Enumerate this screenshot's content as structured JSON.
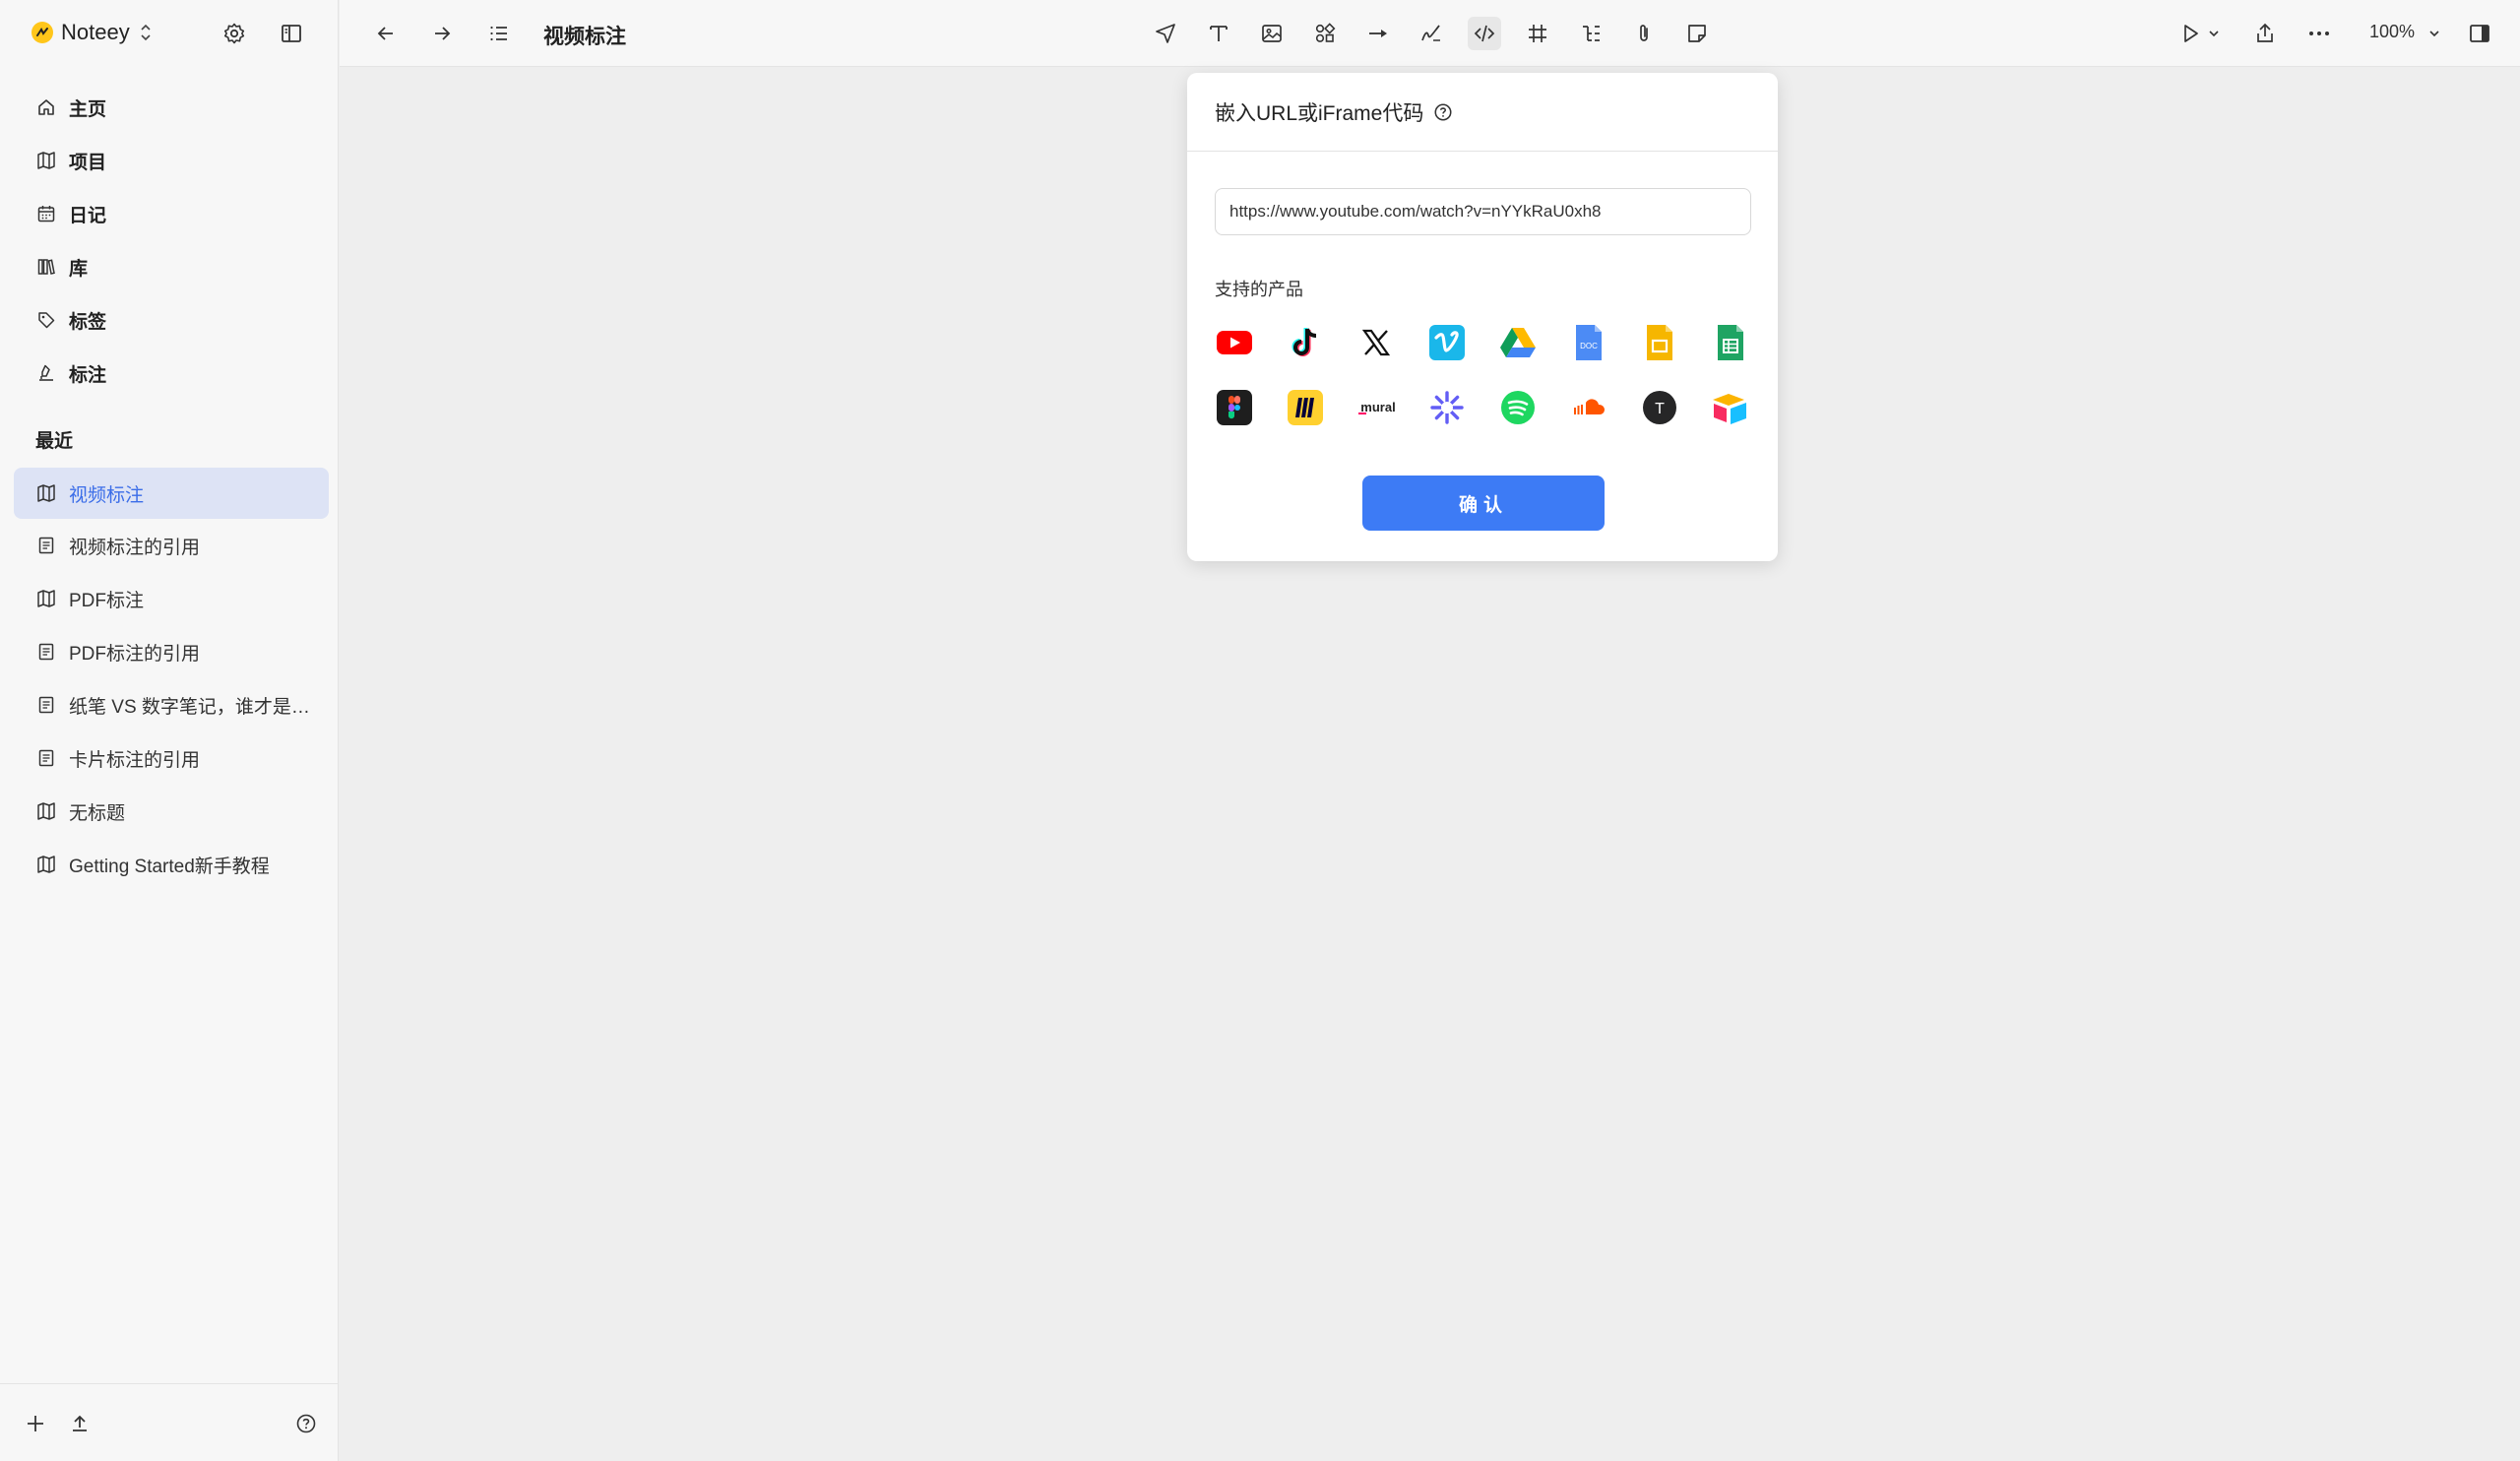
{
  "app": {
    "name": "Noteey"
  },
  "nav": [
    {
      "label": "主页",
      "icon": "home-icon"
    },
    {
      "label": "项目",
      "icon": "map-icon"
    },
    {
      "label": "日记",
      "icon": "calendar-icon"
    },
    {
      "label": "库",
      "icon": "library-icon"
    },
    {
      "label": "标签",
      "icon": "tag-icon"
    },
    {
      "label": "标注",
      "icon": "highlighter-icon"
    }
  ],
  "recent": {
    "title": "最近",
    "items": [
      {
        "label": "视频标注",
        "icon": "map-icon",
        "active": true
      },
      {
        "label": "视频标注的引用",
        "icon": "document-icon"
      },
      {
        "label": "PDF标注",
        "icon": "map-icon"
      },
      {
        "label": "PDF标注的引用",
        "icon": "document-icon"
      },
      {
        "label": "纸笔 VS 数字笔记，谁才是最...",
        "icon": "document-icon"
      },
      {
        "label": "卡片标注的引用",
        "icon": "document-icon"
      },
      {
        "label": "无标题",
        "icon": "map-icon"
      },
      {
        "label": "Getting Started新手教程",
        "icon": "map-icon"
      }
    ]
  },
  "toolbar": {
    "doc_title": "视频标注",
    "zoom": "100%",
    "active_tool": "embed-code-icon"
  },
  "embed_dialog": {
    "title": "嵌入URL或iFrame代码",
    "url_value": "https://www.youtube.com/watch?v=nYYkRaU0xh8",
    "supported_title": "支持的产品",
    "products": [
      "YouTube",
      "TikTok",
      "X",
      "Vimeo",
      "Google Drive",
      "Google Docs",
      "Google Slides",
      "Google Sheets",
      "Figma",
      "Miro",
      "Mural",
      "Loom",
      "Spotify",
      "SoundCloud",
      "Typeform",
      "Airtable"
    ],
    "product_labels": {
      "docs": "DOC",
      "mural": "mural",
      "typeform": "T"
    },
    "confirm_label": "确认"
  },
  "colors": {
    "accent": "#3d7bf5",
    "active_bg": "#dde3f5",
    "youtube": "#ff0000",
    "vimeo": "#1ab7ea",
    "spotify": "#1ed760",
    "soundcloud": "#ff5500",
    "miro": "#ffd02f"
  }
}
